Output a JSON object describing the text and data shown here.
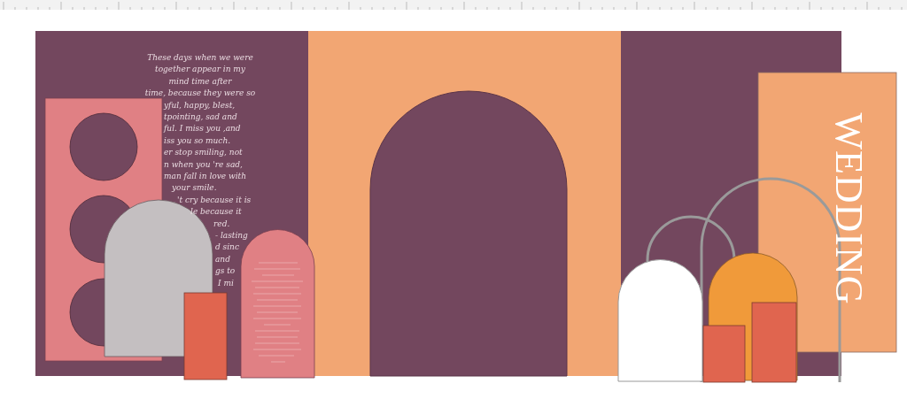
{
  "backdrop": {
    "poem_lines": [
      "These days when we were",
      "together appear in my",
      "mind time after",
      "time, because they were so",
      "yful, happy, blest,",
      "tpointing, sad and",
      "ful. I miss you ,and",
      "iss you so much.",
      "er stop smiling, not",
      "n when you 're sad,",
      "man fall in love with",
      "your smile.",
      "'t cry because it is",
      "le because it",
      "red.",
      "- lasting",
      "d sinc",
      "and",
      "gs to",
      "I mi"
    ],
    "title": "WEDDING"
  }
}
